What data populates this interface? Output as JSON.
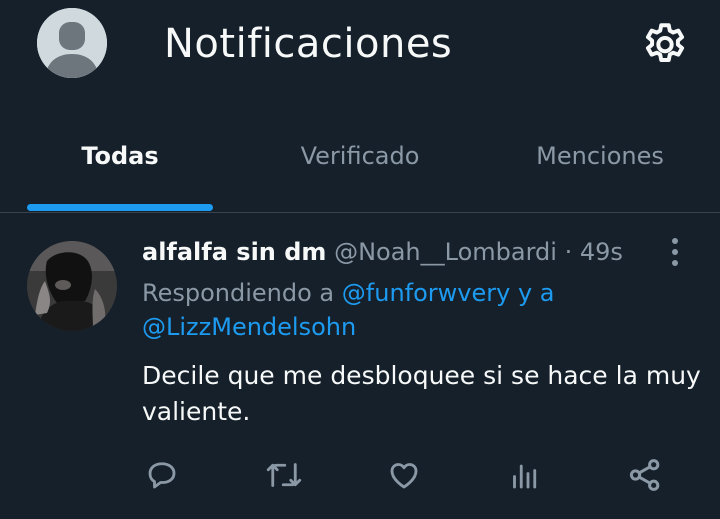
{
  "header": {
    "title": "Notificaciones",
    "avatar_icon": "default-avatar-icon",
    "settings_icon": "gear-icon"
  },
  "tabs": [
    {
      "label": "Todas",
      "active": true
    },
    {
      "label": "Verificado",
      "active": false
    },
    {
      "label": "Menciones",
      "active": false
    }
  ],
  "tweet": {
    "display_name": "alfalfa sin dm",
    "handle": "@Noah__Lombardi",
    "separator": "·",
    "time": "49s",
    "replying_prefix": "Respondiendo a",
    "mention_1": "@funforwvery",
    "replying_and": "y a",
    "mention_2": "@LizzMendelsohn",
    "text": "Decile que me desbloquee si se hace la muy valiente.",
    "actions": [
      "reply-icon",
      "retweet-icon",
      "like-icon",
      "analytics-icon",
      "share-icon"
    ]
  },
  "colors": {
    "background": "#15202b",
    "accent": "#1d9bf0",
    "secondary_text": "#8b98a5",
    "primary_text": "#f7f9f9"
  }
}
